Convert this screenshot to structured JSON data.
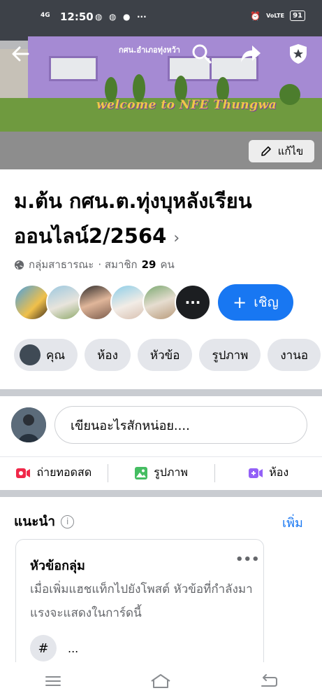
{
  "status_bar": {
    "network": "4G",
    "time": "12:50",
    "volte": "VoLTE",
    "battery": "91"
  },
  "cover": {
    "sign_text": "กศน.อำเภอทุ่งหว้า",
    "welcome_text": "welcome to NFE Thungwa",
    "edit_label": "แก้ไข"
  },
  "group": {
    "name": "ม.ต้น กศน.ต.ทุ่งบุหลังเรียนออนไลน์2/2564",
    "privacy": "กลุ่มสาธารณะ",
    "members_prefix": "· สมาชิก",
    "members_count": "29",
    "members_suffix": "คน",
    "more_members": "···",
    "invite_label": "เชิญ"
  },
  "tabs": [
    {
      "label": "คุณ"
    },
    {
      "label": "ห้อง"
    },
    {
      "label": "หัวข้อ"
    },
    {
      "label": "รูปภาพ"
    },
    {
      "label": "งานอ"
    }
  ],
  "composer": {
    "placeholder": "เขียนอะไรสักหน่อย...."
  },
  "actions": [
    {
      "label": "ถ่ายทอดสด",
      "icon": "live-video-icon",
      "color": "#f02849"
    },
    {
      "label": "รูปภาพ",
      "icon": "photo-icon",
      "color": "#45bd62"
    },
    {
      "label": "ห้อง",
      "icon": "room-icon",
      "color": "#9360f7"
    }
  ],
  "suggestions": {
    "title": "แนะนำ",
    "see_more": "เพิ่ม",
    "card": {
      "title": "หัวข้อกลุ่ม",
      "description": "เมื่อเพิ่มแฮชแท็กไปยังโพสต์ หัวข้อที่กำลังมาแรงจะแสดงในการ์ดนี้",
      "hash_symbol": "#",
      "ellipsis": "..."
    }
  },
  "colors": {
    "accent": "#1877f2",
    "chip_bg": "#e4e6eb",
    "divider": "#c9ccd1"
  }
}
